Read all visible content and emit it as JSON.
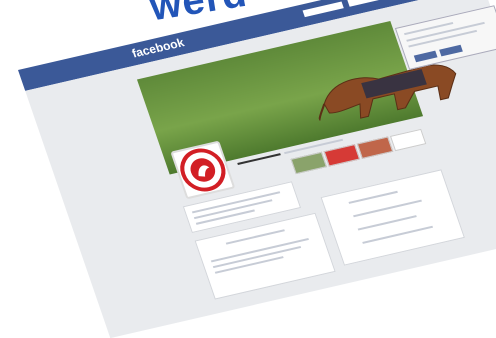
{
  "headline": {
    "text": "werd"
  },
  "facebook": {
    "logo_text": "facebook"
  },
  "colors": {
    "facebook_blue": "#3b5998",
    "headline_blue": "#2255b8",
    "page_bg": "#e9ebee"
  }
}
